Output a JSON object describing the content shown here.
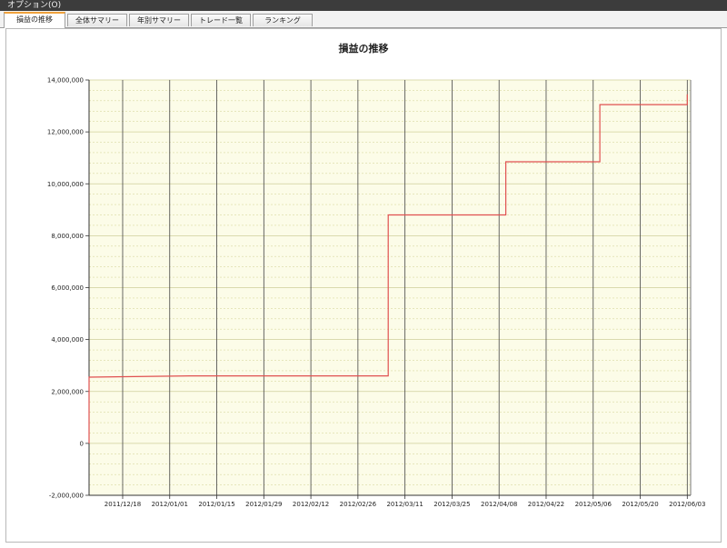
{
  "menubar": {
    "option_label": "オプション(O)"
  },
  "tabs": [
    {
      "label": "損益の推移",
      "active": true
    },
    {
      "label": "全体サマリー",
      "active": false
    },
    {
      "label": "年別サマリー",
      "active": false
    },
    {
      "label": "トレード一覧",
      "active": false
    },
    {
      "label": "ランキング",
      "active": false
    }
  ],
  "colors": {
    "plot_background": "#fcfce8",
    "major_grid": "#444444",
    "minor_grid": "#d9d9a0",
    "series": "#e05050"
  },
  "chart_data": {
    "type": "line",
    "step": true,
    "title": "損益の推移",
    "xlabel": "",
    "ylabel": "",
    "ylim": [
      -2000000,
      14000000
    ],
    "xlim": [
      "2011-12-08",
      "2012-06-04"
    ],
    "y_ticks": [
      -2000000,
      0,
      2000000,
      4000000,
      6000000,
      8000000,
      10000000,
      12000000,
      14000000
    ],
    "y_tick_labels": [
      "-2,000,000",
      "0",
      "2,000,000",
      "4,000,000",
      "6,000,000",
      "8,000,000",
      "10,000,000",
      "12,000,000",
      "14,000,000"
    ],
    "x_ticks": [
      "2011-12-18",
      "2012-01-01",
      "2012-01-15",
      "2012-01-29",
      "2012-02-12",
      "2012-02-26",
      "2012-03-11",
      "2012-03-25",
      "2012-04-08",
      "2012-04-22",
      "2012-05-06",
      "2012-05-20",
      "2012-06-03"
    ],
    "x_tick_labels": [
      "2011/12/18",
      "2012/01/01",
      "2012/01/15",
      "2012/01/29",
      "2012/02/12",
      "2012/02/26",
      "2012/03/11",
      "2012/03/25",
      "2012/04/08",
      "2012/04/22",
      "2012/05/06",
      "2012/05/20",
      "2012/06/03"
    ],
    "grid": true,
    "series": [
      {
        "x": [
          "2011-12-08",
          "2011-12-08",
          "2012-01-07",
          "2012-03-06",
          "2012-03-06",
          "2012-04-10",
          "2012-04-10",
          "2012-05-08",
          "2012-05-08",
          "2012-06-03",
          "2012-06-03"
        ],
        "values": [
          0,
          2550000,
          2600000,
          2600000,
          8800000,
          8800000,
          10850000,
          10850000,
          13050000,
          13050000,
          13450000
        ]
      }
    ]
  }
}
